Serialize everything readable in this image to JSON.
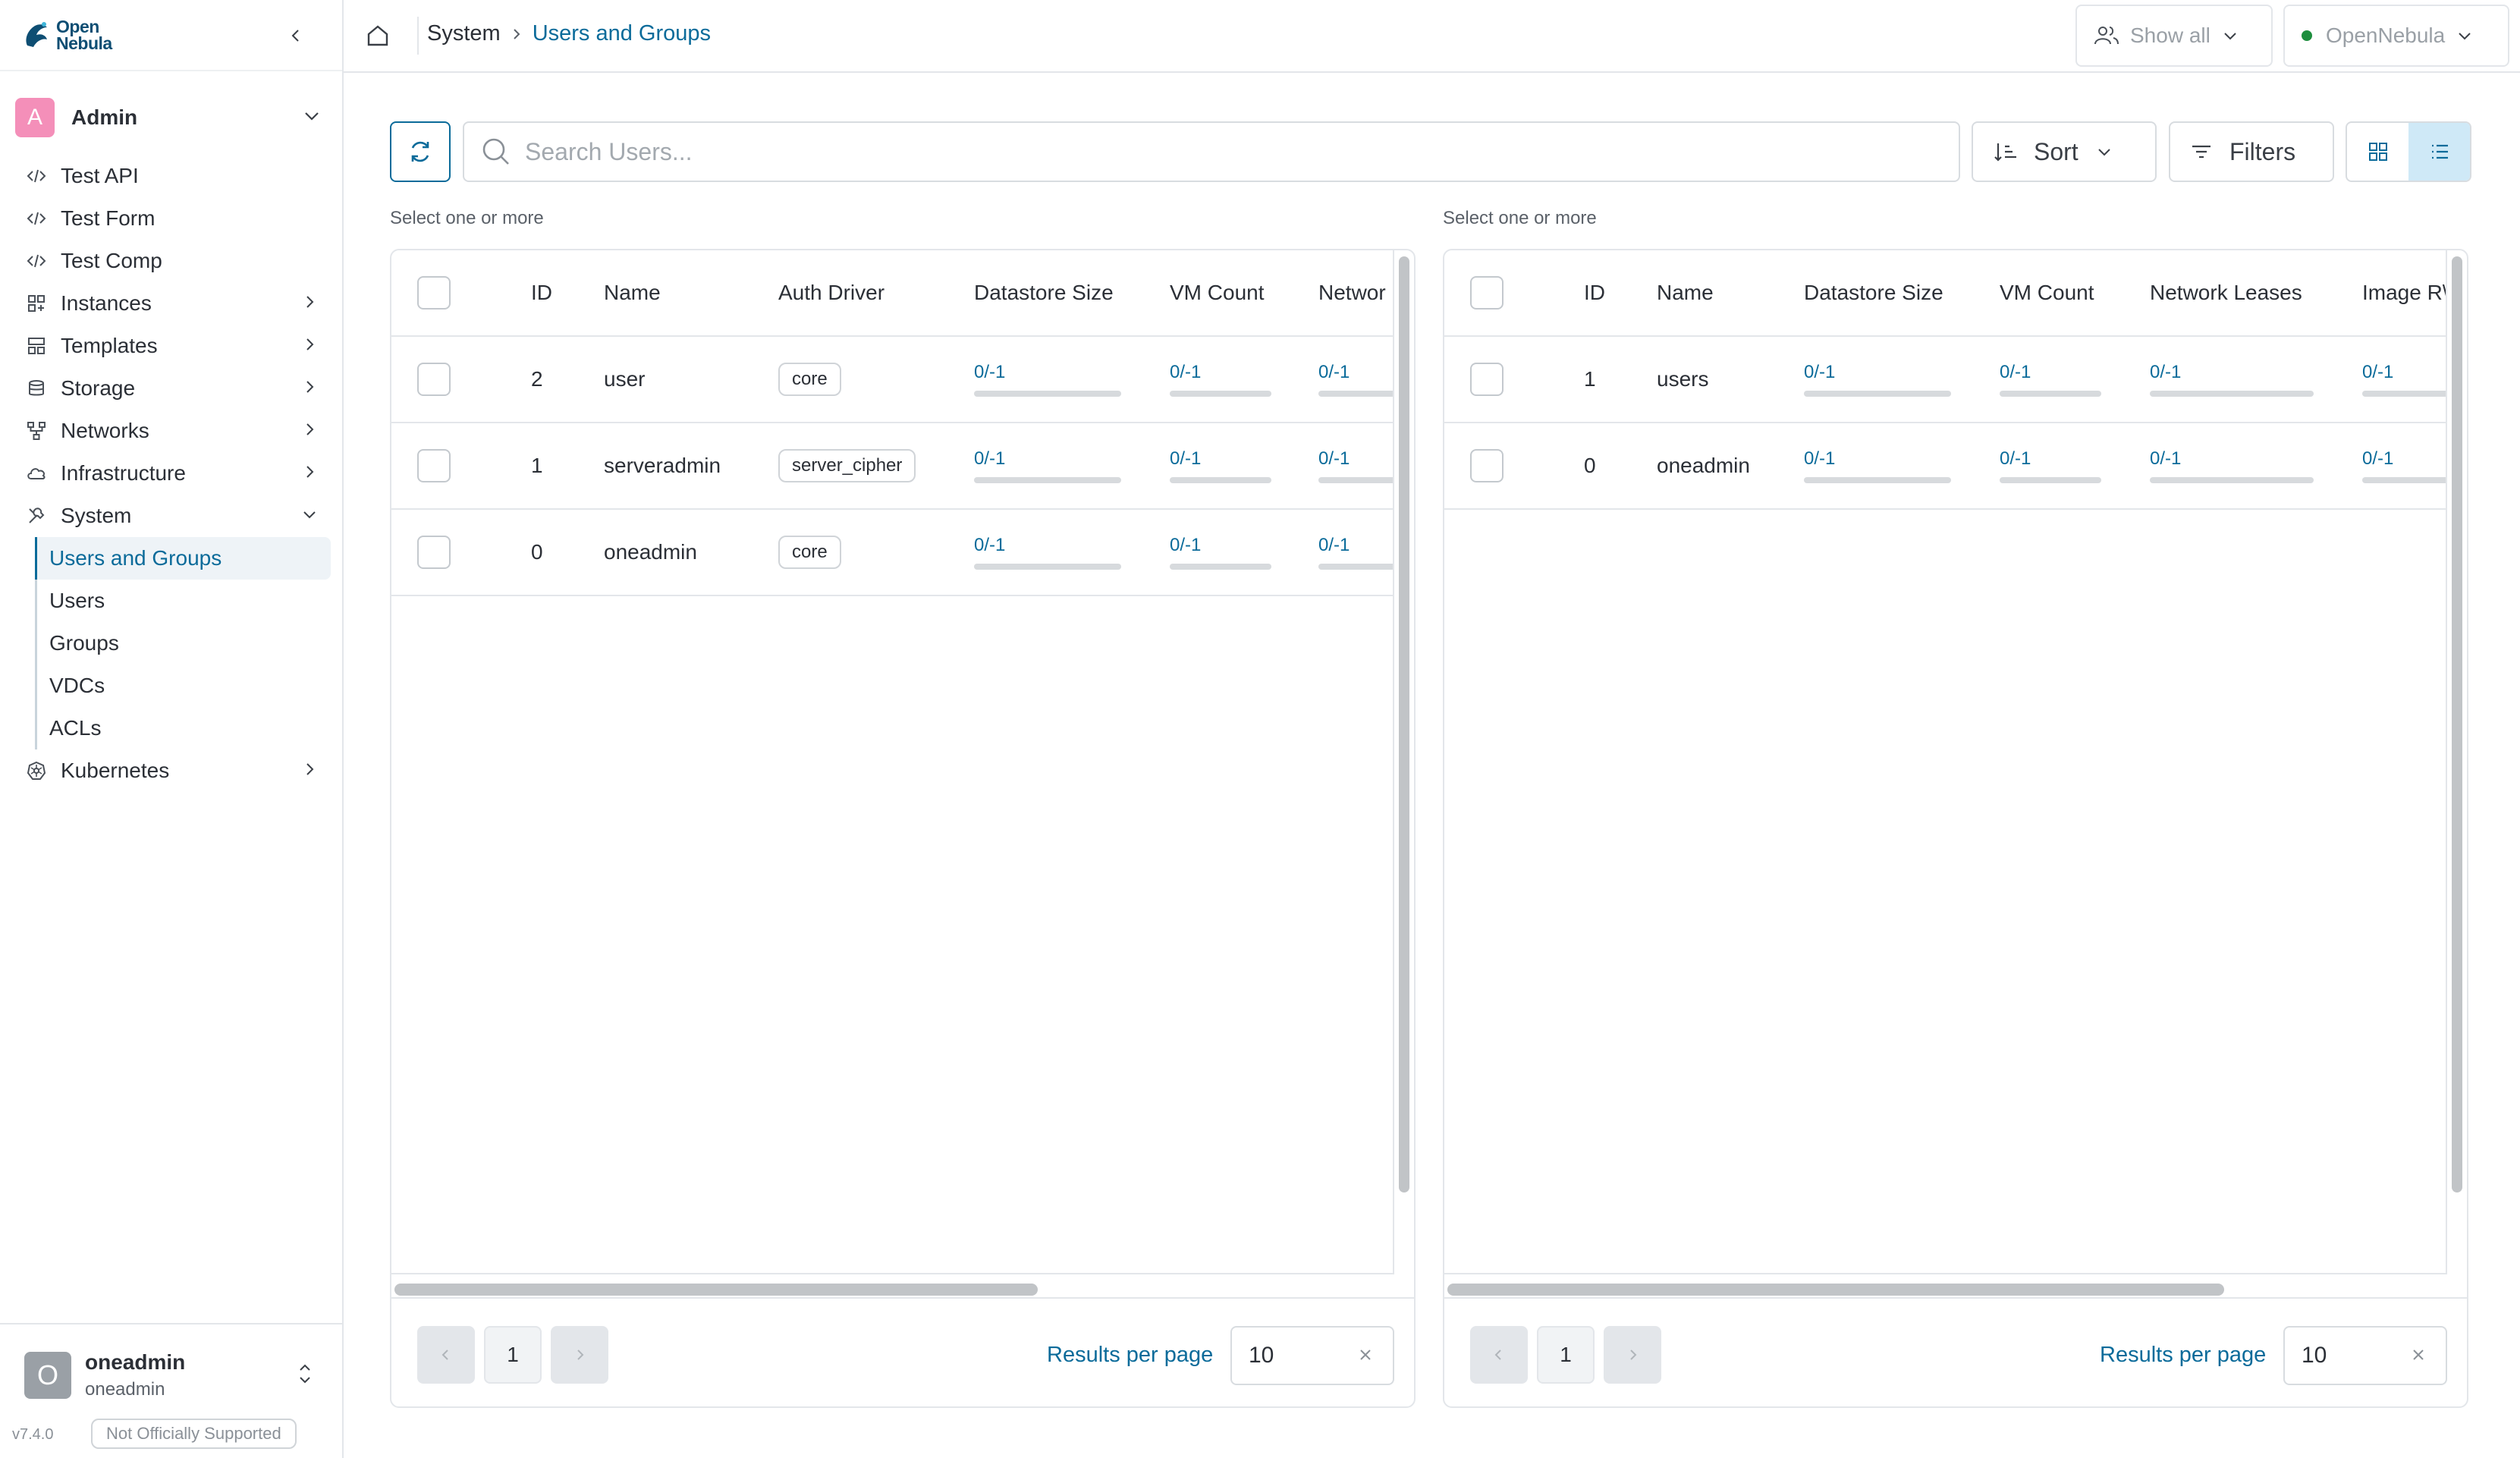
{
  "app": {
    "logo_line1": "Open",
    "logo_line2": "Nebula",
    "brand_color": "#0b6b9a"
  },
  "sidebar": {
    "group": {
      "avatar_letter": "A",
      "name": "Admin"
    },
    "items": [
      {
        "label": "Test API",
        "icon": "code-icon",
        "expandable": false
      },
      {
        "label": "Test Form",
        "icon": "code-icon",
        "expandable": false
      },
      {
        "label": "Test Comp",
        "icon": "code-icon",
        "expandable": false
      },
      {
        "label": "Instances",
        "icon": "grid-icon",
        "expandable": true
      },
      {
        "label": "Templates",
        "icon": "template-icon",
        "expandable": true
      },
      {
        "label": "Storage",
        "icon": "database-icon",
        "expandable": true
      },
      {
        "label": "Networks",
        "icon": "network-icon",
        "expandable": true
      },
      {
        "label": "Infrastructure",
        "icon": "cloud-icon",
        "expandable": true
      },
      {
        "label": "System",
        "icon": "tools-icon",
        "expandable": true,
        "expanded": true
      }
    ],
    "system_sub": [
      "Users and Groups",
      "Users",
      "Groups",
      "VDCs",
      "ACLs"
    ],
    "after_items": [
      {
        "label": "Kubernetes",
        "icon": "kubernetes-icon",
        "expandable": true
      }
    ],
    "user": {
      "avatar_letter": "O",
      "name": "oneadmin",
      "sub": "oneadmin"
    },
    "version": "v7.4.0",
    "badge": "Not Officially Supported"
  },
  "topbar": {
    "breadcrumb": [
      "System",
      "Users and Groups"
    ],
    "show_all": "Show all",
    "zone": "OpenNebula"
  },
  "toolbar": {
    "search_placeholder": "Search Users...",
    "sort": "Sort",
    "filters": "Filters"
  },
  "left_panel": {
    "hint": "Select one or more",
    "columns": [
      "ID",
      "Name",
      "Auth Driver",
      "Datastore Size",
      "VM Count",
      "Networ"
    ],
    "rows": [
      {
        "id": "2",
        "name": "user",
        "auth": "core",
        "ds": "0/-1",
        "vm": "0/-1",
        "net": "0/-1"
      },
      {
        "id": "1",
        "name": "serveradmin",
        "auth": "server_cipher",
        "ds": "0/-1",
        "vm": "0/-1",
        "net": "0/-1"
      },
      {
        "id": "0",
        "name": "oneadmin",
        "auth": "core",
        "ds": "0/-1",
        "vm": "0/-1",
        "net": "0/-1"
      }
    ],
    "page": "1",
    "rpp_label": "Results per page",
    "rpp_value": "10"
  },
  "right_panel": {
    "hint": "Select one or more",
    "columns": [
      "ID",
      "Name",
      "Datastore Size",
      "VM Count",
      "Network Leases",
      "Image R\\"
    ],
    "rows": [
      {
        "id": "1",
        "name": "users",
        "ds": "0/-1",
        "vm": "0/-1",
        "net": "0/-1",
        "img": "0/-1"
      },
      {
        "id": "0",
        "name": "oneadmin",
        "ds": "0/-1",
        "vm": "0/-1",
        "net": "0/-1",
        "img": "0/-1"
      }
    ],
    "page": "1",
    "rpp_label": "Results per page",
    "rpp_value": "10"
  }
}
